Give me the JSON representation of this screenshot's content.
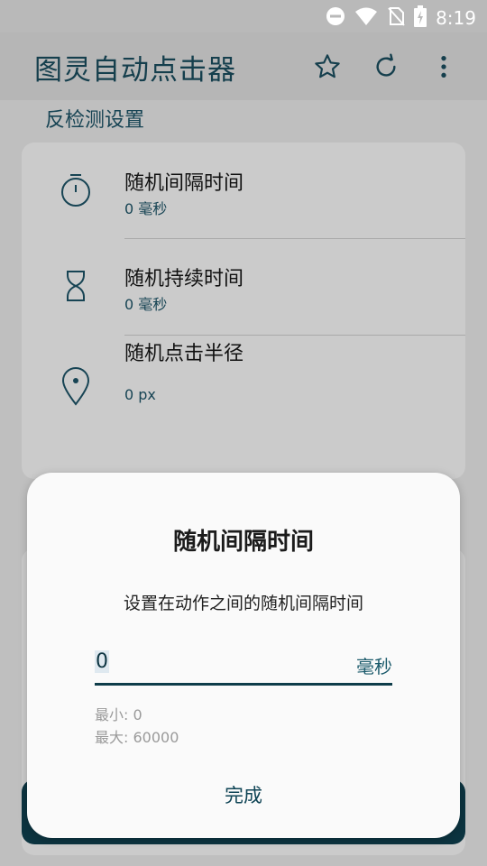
{
  "status_bar": {
    "time": "8:19"
  },
  "app_bar": {
    "title": "图灵自动点击器",
    "actions": [
      "star-icon",
      "refresh-icon",
      "more-vert-icon"
    ]
  },
  "section": {
    "title": "反检测设置",
    "items": [
      {
        "label": "随机间隔时间",
        "value": "0 毫秒",
        "icon": "timer-icon"
      },
      {
        "label": "随机持续时间",
        "value": "0 毫秒",
        "icon": "hourglass-icon"
      },
      {
        "label": "随机点击半径",
        "value": "0 px",
        "icon": "location-pin-icon",
        "slider_fraction": 0
      }
    ]
  },
  "dialog": {
    "title": "随机间隔时间",
    "description": "设置在动作之间的随机间隔时间",
    "input_value": "0",
    "unit": "毫秒",
    "min_hint": "最小: 0",
    "max_hint": "最大: 60000",
    "done_label": "完成"
  },
  "colors": {
    "accent": "#0f3d4a",
    "dialog_bg": "#fafafa",
    "scrim": "#bfbfbf"
  }
}
